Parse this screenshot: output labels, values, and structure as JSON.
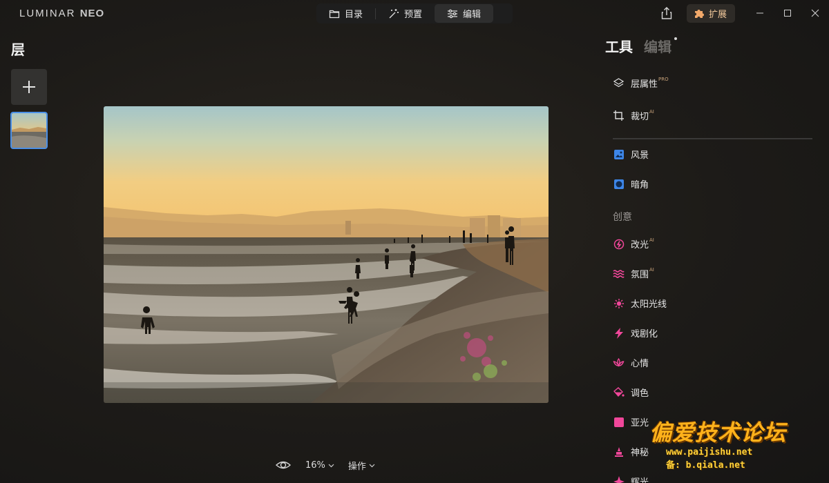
{
  "app": {
    "logo_main": "LUMINAR",
    "logo_neo": "NEO"
  },
  "modes": [
    {
      "label": "目录",
      "icon": "folder-icon"
    },
    {
      "label": "预置",
      "icon": "magic-wand-icon"
    },
    {
      "label": "编辑",
      "icon": "sliders-icon",
      "active": true
    }
  ],
  "titlebar": {
    "extensions_label": "扩展",
    "share_icon": "share-icon",
    "window_controls": [
      "minimize-icon",
      "maximize-icon",
      "close-icon"
    ]
  },
  "layers": {
    "title": "层",
    "add_icon": "plus-icon"
  },
  "bottom_bar": {
    "zoom": "16%",
    "actions_label": "操作"
  },
  "right_panel": {
    "tabs": [
      {
        "label": "工具",
        "active": true
      },
      {
        "label": "编辑",
        "active": false
      }
    ],
    "top_tools": [
      {
        "label": "层属性",
        "badge": "PRO",
        "icon": "layers-icon"
      },
      {
        "label": "裁切",
        "badge": "AI",
        "icon": "crop-icon"
      }
    ],
    "basic_tools": [
      {
        "label": "风景",
        "badge": "",
        "icon": "landscape-icon",
        "color": "#3d86e8"
      },
      {
        "label": "暗角",
        "badge": "",
        "icon": "vignette-icon",
        "color": "#3d86e8"
      }
    ],
    "creative_label": "创意",
    "creative_tools": [
      {
        "label": "改光",
        "badge": "AI",
        "icon": "relight-icon",
        "color": "#f0479a"
      },
      {
        "label": "氛围",
        "badge": "AI",
        "icon": "atmosphere-icon",
        "color": "#f0479a"
      },
      {
        "label": "太阳光线",
        "badge": "",
        "icon": "sunrays-icon",
        "color": "#f0479a"
      },
      {
        "label": "戏剧化",
        "badge": "",
        "icon": "lightning-icon",
        "color": "#f0479a"
      },
      {
        "label": "心情",
        "badge": "",
        "icon": "lotus-icon",
        "color": "#f0479a"
      },
      {
        "label": "调色",
        "badge": "",
        "icon": "paint-bucket-icon",
        "color": "#f0479a"
      },
      {
        "label": "亚光",
        "badge": "",
        "icon": "matte-icon",
        "color": "#f0479a"
      },
      {
        "label": "神秘",
        "badge": "",
        "icon": "mystic-icon",
        "color": "#f0479a"
      },
      {
        "label": "辉光",
        "badge": "",
        "icon": "glow-icon",
        "color": "#f0479a"
      }
    ]
  },
  "watermark": {
    "main": "偏爱技术论坛",
    "url": "www.paijishu.net",
    "backup": "备: b.qiala.net"
  },
  "colors": {
    "accent_blue": "#4a8fe7",
    "creative_pink": "#f0479a",
    "ext_gold": "#f1c89a"
  }
}
